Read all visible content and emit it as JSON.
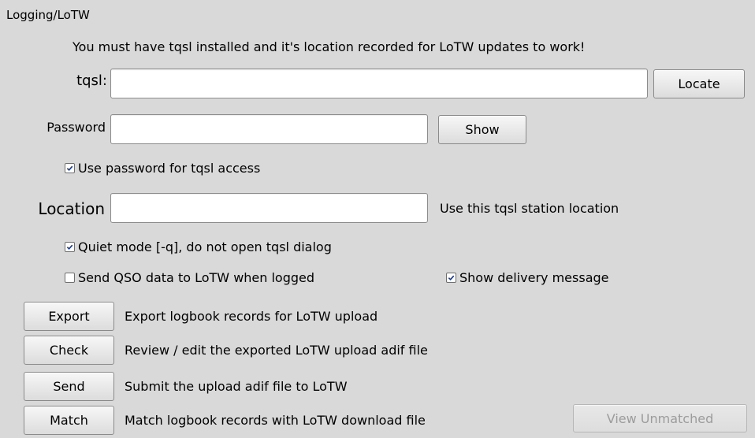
{
  "group": {
    "title": "Logging/LoTW"
  },
  "notice": "You must have tqsl installed and it's location recorded for LoTW updates to work!",
  "tqsl": {
    "label": "tqsl:",
    "value": "",
    "locate_label": "Locate"
  },
  "password": {
    "label": "Password",
    "value": "",
    "show_label": "Show"
  },
  "use_password": {
    "label": "Use password for tqsl access",
    "checked": true
  },
  "location": {
    "label": "Location",
    "value": "",
    "hint": "Use this tqsl station location"
  },
  "quiet_mode": {
    "label": "Quiet mode [-q], do not open tqsl dialog",
    "checked": true
  },
  "send_qso": {
    "label": "Send QSO data to LoTW when logged",
    "checked": false
  },
  "show_delivery": {
    "label": "Show delivery message",
    "checked": true
  },
  "actions": [
    {
      "button": "Export",
      "description": "Export logbook records for LoTW upload"
    },
    {
      "button": "Check",
      "description": "Review / edit the exported LoTW upload adif file"
    },
    {
      "button": "Send",
      "description": "Submit the upload adif file to LoTW"
    },
    {
      "button": "Match",
      "description": "Match logbook records with LoTW download file"
    }
  ],
  "view_unmatched": {
    "label": "View Unmatched",
    "enabled": false
  },
  "icons": {
    "check_mark": "checkmark-icon"
  }
}
